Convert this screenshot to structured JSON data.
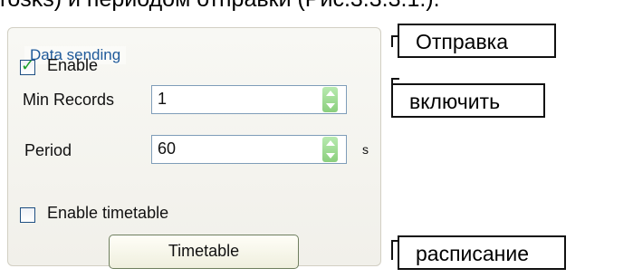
{
  "top_text": "rosks) и периодом отправки (Рис.3.3.3.1.).",
  "group": {
    "title": "Data sending",
    "enable_label": "Enable",
    "min_records_label": "Min Records",
    "min_records_value": "1",
    "period_label": "Period",
    "period_value": "60",
    "period_unit": "s",
    "timetable_label": "Enable timetable",
    "timetable_button": "Timetable"
  },
  "callouts": {
    "send": "Отправка",
    "enable": "включить",
    "schedule": "расписание"
  }
}
